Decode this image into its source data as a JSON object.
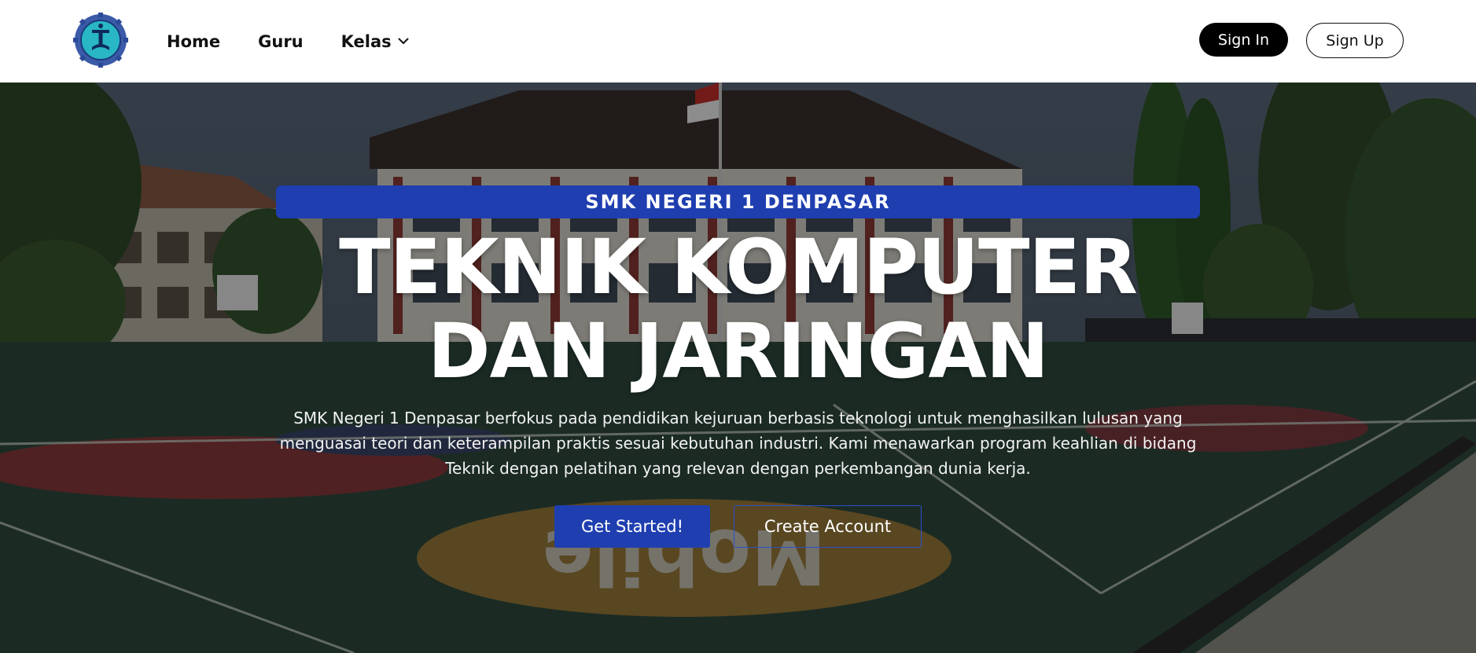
{
  "nav": {
    "logo": "school-logo",
    "links": [
      {
        "label": "Home"
      },
      {
        "label": "Guru"
      },
      {
        "label": "Kelas",
        "icon": "chevron-down-icon"
      }
    ],
    "sign_in": "Sign In",
    "sign_up": "Sign Up"
  },
  "hero": {
    "badge": "SMK NEGERI 1 DENPASAR",
    "title_line1": "TEKNIK KOMPUTER",
    "title_line2": "DAN JARINGAN",
    "description": "SMK Negeri 1 Denpasar berfokus pada pendidikan kejuruan berbasis teknologi untuk menghasilkan lulusan yang menguasai teori dan keterampilan praktis sesuai kebutuhan industri. Kami menawarkan program keahlian di bidang Teknik dengan pelatihan yang relevan dengan perkembangan dunia kerja.",
    "primary_button": "Get Started!",
    "secondary_button": "Create Account",
    "court_text": "Mobile"
  },
  "colors": {
    "accent": "#1f3eb0",
    "nav_bg": "#ffffff",
    "signin_bg": "#000000"
  }
}
